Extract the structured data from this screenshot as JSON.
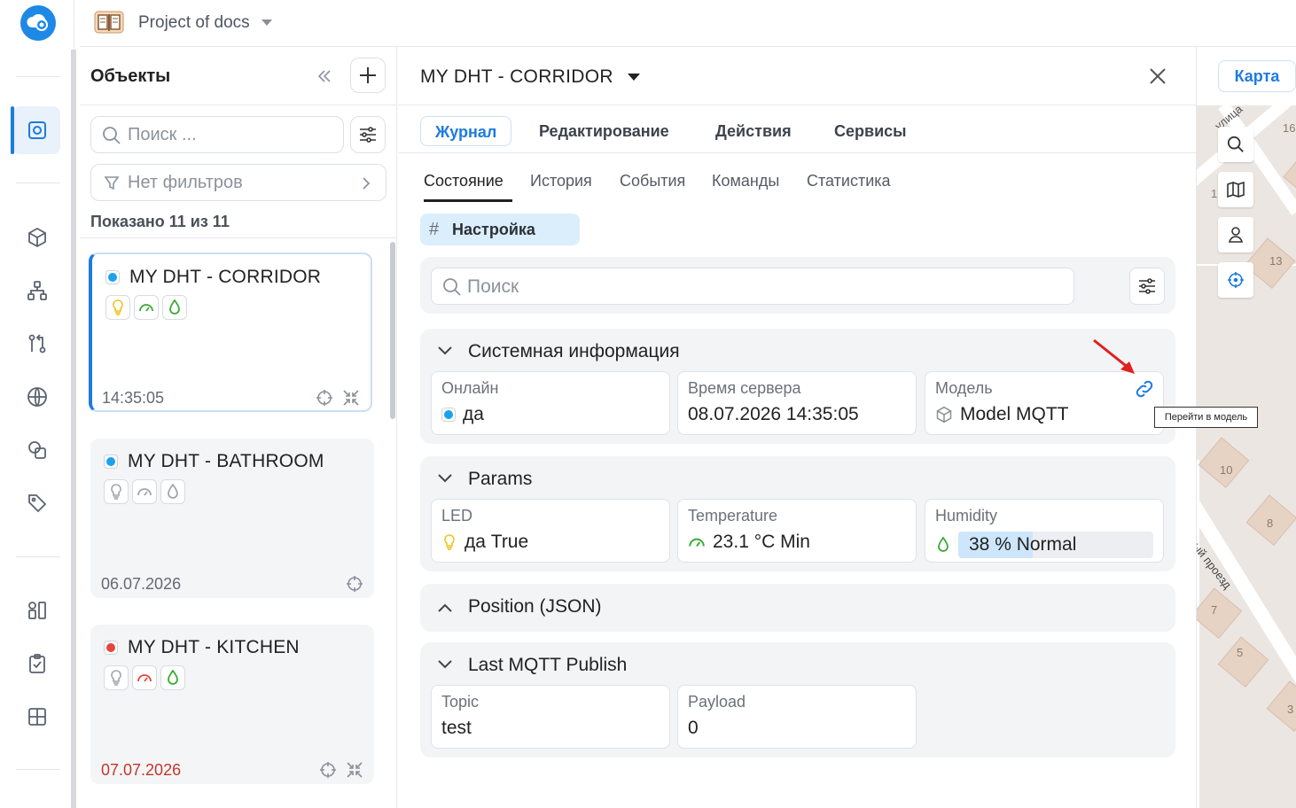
{
  "header": {
    "project_title": "Project of docs"
  },
  "objects_panel": {
    "title": "Объекты",
    "search_placeholder": "Поиск ...",
    "filter_label": "Нет фильтров",
    "shown_count": "Показано 11 из 11",
    "cards": [
      {
        "title": "MY DHT - CORRIDOR",
        "status_color": "#1aa3ec",
        "time": "14:35:05",
        "chip_colors": [
          "#f0c419",
          "#3aaa35",
          "#3aaa35"
        ]
      },
      {
        "title": "MY DHT - BATHROOM",
        "status_color": "#1aa3ec",
        "time": "06.07.2026",
        "chip_colors": [
          "#a0a5ac",
          "#a0a5ac",
          "#a0a5ac"
        ]
      },
      {
        "title": "MY DHT - KITCHEN",
        "status_color": "#e8453c",
        "time": "07.07.2026",
        "chip_colors": [
          "#a0a5ac",
          "#e8453c",
          "#3aaa35"
        ]
      }
    ]
  },
  "main": {
    "title": "MY DHT - CORRIDOR",
    "tabs": [
      "Журнал",
      "Редактирование",
      "Действия",
      "Сервисы"
    ],
    "subtabs": [
      "Состояние",
      "История",
      "События",
      "Команды",
      "Статистика"
    ],
    "settings_tag": "Настройка",
    "search_placeholder": "Поиск",
    "sections": {
      "system": {
        "title": "Системная информация",
        "online_label": "Онлайн",
        "online_value": "да",
        "server_time_label": "Время сервера",
        "server_time_value": "08.07.2026 14:35:05",
        "model_label": "Модель",
        "model_value": "Model MQTT",
        "tooltip": "Перейти в модель"
      },
      "params": {
        "title": "Params",
        "led_label": "LED",
        "led_value": "да True",
        "temp_label": "Temperature",
        "temp_value": "23.1 °C Min",
        "hum_label": "Humidity",
        "hum_value": "38 % Normal",
        "hum_fraction": 0.38
      },
      "position": {
        "title": "Position (JSON)"
      },
      "mqtt": {
        "title": "Last MQTT Publish",
        "topic_label": "Topic",
        "topic_value": "test",
        "payload_label": "Payload",
        "payload_value": "0"
      }
    }
  },
  "map": {
    "button_label": "Карта",
    "labels": [
      "улица",
      "16",
      "1",
      "13",
      "10",
      "8",
      "тный проезд",
      "7",
      "5",
      "3"
    ]
  },
  "colors": {
    "accent": "#1e7be0",
    "online": "#1aa3ec",
    "offline": "#e8453c"
  }
}
